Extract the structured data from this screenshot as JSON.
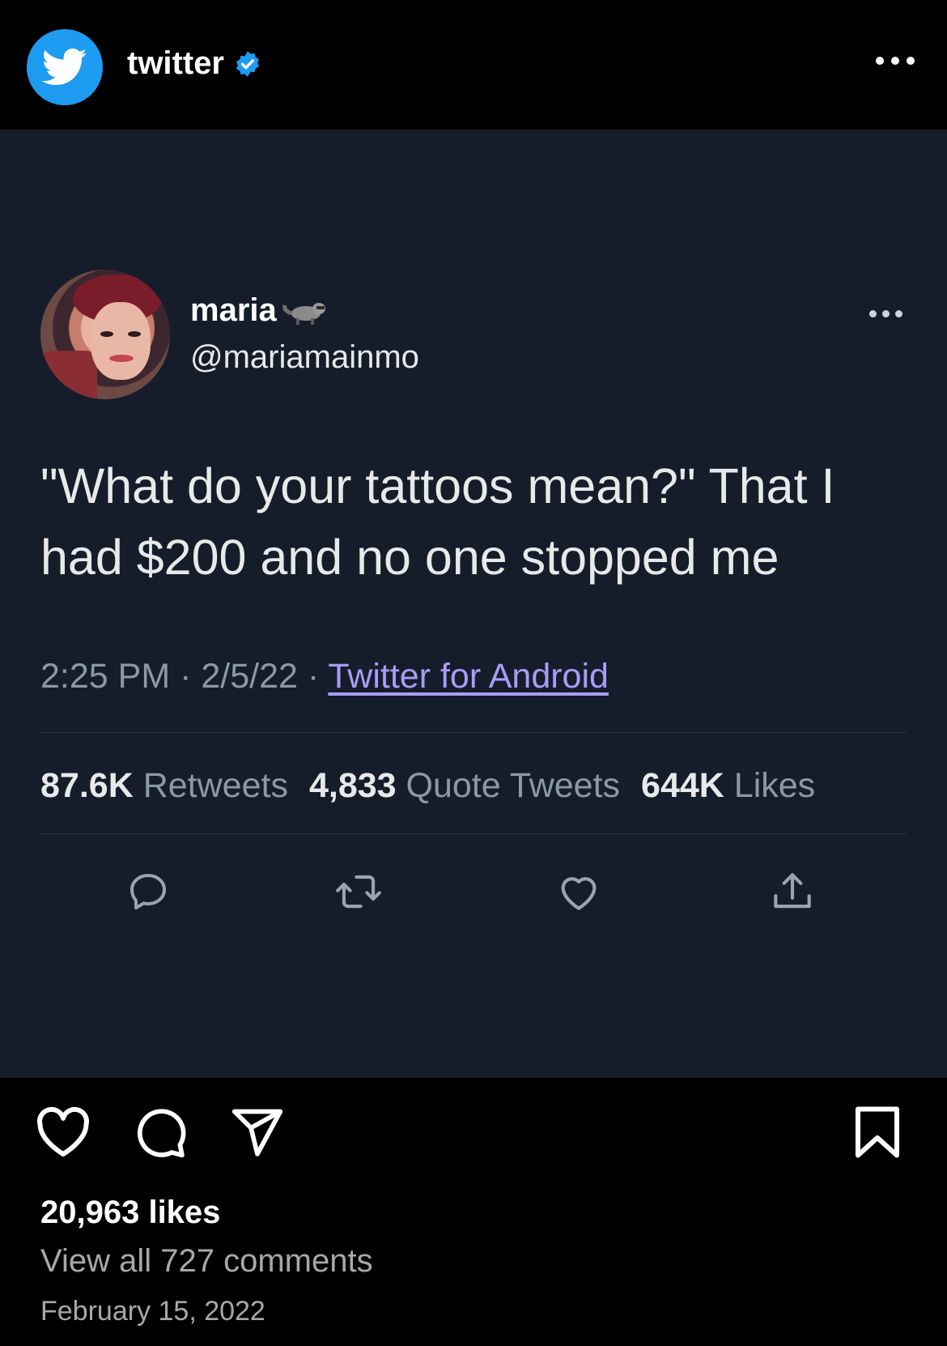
{
  "header": {
    "account_name": "twitter",
    "more_icon": "ellipsis-icon"
  },
  "tweet": {
    "display_name": "maria",
    "handle": "@mariamainmo",
    "text": "\"What do your tattoos mean?\" That I had $200 and no one stopped me",
    "time": "2:25 PM",
    "date": "2/5/22",
    "separator": "·",
    "source": "Twitter for Android",
    "stats": [
      {
        "value": "87.6K",
        "label": "Retweets"
      },
      {
        "value": "4,833",
        "label": "Quote Tweets"
      },
      {
        "value": "644K",
        "label": "Likes"
      }
    ]
  },
  "footer": {
    "likes": "20,963 likes",
    "comments": "View all 727 comments",
    "date": "February 15, 2022"
  },
  "colors": {
    "card_background": "#151d2b",
    "twitter_blue": "#1d9bf0",
    "source_link": "#a99cf6"
  }
}
